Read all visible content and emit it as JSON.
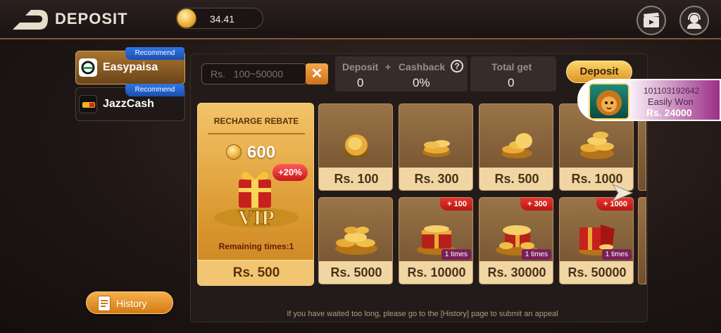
{
  "header": {
    "title": "DEPOSIT",
    "balance": "34.41"
  },
  "sidebar": {
    "methods": [
      {
        "label": "Easypaisa",
        "badge": "Recommend",
        "active": true
      },
      {
        "label": "JazzCash",
        "badge": "Recommend",
        "active": false
      }
    ],
    "history_label": "History"
  },
  "form": {
    "amount_placeholder": "Rs.   100~50000",
    "clear_symbol": "✕",
    "deposit_label": "Deposit",
    "cashback_label": "Cashback",
    "plus_symbol": "+",
    "deposit_value": "0",
    "cashback_value": "0%",
    "help_symbol": "?",
    "total_label": "Total get",
    "total_value": "0",
    "deposit_button": "Deposit"
  },
  "rebate": {
    "title": "RECHARGE REBATE",
    "amount": "600",
    "bonus": "+20%",
    "remaining": "Remaining times:1",
    "price": "Rs. 500"
  },
  "cards": [
    {
      "label": "Rs. 100",
      "bonus": "",
      "times": ""
    },
    {
      "label": "Rs. 300",
      "bonus": "",
      "times": ""
    },
    {
      "label": "Rs. 500",
      "bonus": "",
      "times": ""
    },
    {
      "label": "Rs. 1000",
      "bonus": "",
      "times": ""
    },
    {
      "label": "Rs. 5000",
      "bonus": "",
      "times": ""
    },
    {
      "label": "Rs. 10000",
      "bonus": "+ 100",
      "times": "1 times"
    },
    {
      "label": "Rs. 30000",
      "bonus": "+ 300",
      "times": "1 times"
    },
    {
      "label": "Rs. 50000",
      "bonus": "+ 1000",
      "times": "1 times"
    }
  ],
  "footer_note": "If you have waited too long, please go to the [History] page to submit an appeal",
  "win_toast": {
    "user_id": "101103192642",
    "message": "Easily Won",
    "amount": "Rs. 24000"
  }
}
